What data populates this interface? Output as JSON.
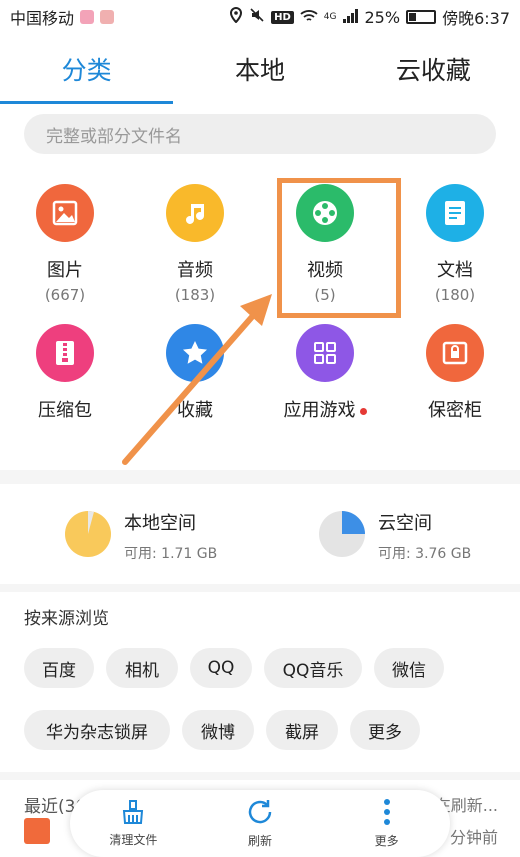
{
  "status_bar": {
    "carrier": "中国移动",
    "network": "4G",
    "battery": "25%",
    "time": "傍晚6:37"
  },
  "tabs": [
    {
      "label": "分类",
      "active": true
    },
    {
      "label": "本地",
      "active": false
    },
    {
      "label": "云收藏",
      "active": false
    }
  ],
  "search": {
    "placeholder": "完整或部分文件名"
  },
  "categories": [
    {
      "label": "图片",
      "count": "(667)",
      "icon": "image-icon",
      "color": "#f0673d"
    },
    {
      "label": "音频",
      "count": "(183)",
      "icon": "music-icon",
      "color": "#f9b92b"
    },
    {
      "label": "视频",
      "count": "(5)",
      "icon": "film-icon",
      "color": "#2bbb6a"
    },
    {
      "label": "文档",
      "count": "(180)",
      "icon": "document-icon",
      "color": "#1eb0e6"
    },
    {
      "label": "压缩包",
      "count": "",
      "icon": "zip-icon",
      "color": "#ee3f7e"
    },
    {
      "label": "收藏",
      "count": "",
      "icon": "star-icon",
      "color": "#2f87e6"
    },
    {
      "label": "应用游戏",
      "count": "",
      "icon": "apps-icon",
      "color": "#8e57e6"
    },
    {
      "label": "保密柜",
      "count": "",
      "icon": "safe-icon",
      "color": "#f0673d"
    }
  ],
  "storage": {
    "local": {
      "title": "本地空间",
      "available": "可用: 1.71 GB",
      "used_fraction": 0.95
    },
    "cloud": {
      "title": "云空间",
      "available": "可用: 3.76 GB",
      "used_fraction": 0.25
    }
  },
  "source_browse": {
    "title": "按来源浏览",
    "chips": [
      "百度",
      "相机",
      "QQ",
      "QQ音乐",
      "微信",
      "华为杂志锁屏",
      "微博",
      "截屏",
      "更多"
    ]
  },
  "recent": {
    "title": "最近(30 天)",
    "status": "正在刷新...",
    "time": "分钟前"
  },
  "bottom_bar": [
    {
      "label": "清理文件",
      "icon": "broom-icon"
    },
    {
      "label": "刷新",
      "icon": "refresh-icon"
    },
    {
      "label": "更多",
      "icon": "more-vertical-icon"
    }
  ],
  "colors": {
    "accent": "#1e88d8",
    "annotation": "#f0924a"
  }
}
